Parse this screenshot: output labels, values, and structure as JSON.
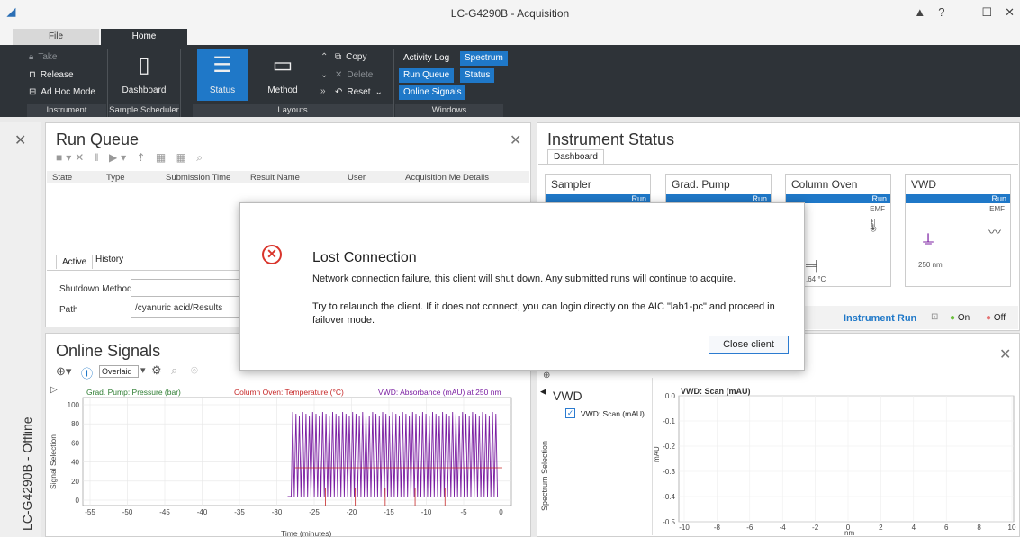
{
  "window": {
    "title": "LC-G4290B - Acquisition",
    "controls": [
      "▲",
      "?",
      "—",
      "☐",
      "✕"
    ]
  },
  "tabs": {
    "file": "File",
    "home": "Home"
  },
  "ribbon": {
    "instrument": {
      "take": "Take",
      "release": "Release",
      "adhoc": "Ad Hoc Mode",
      "label": "Instrument"
    },
    "scheduler": {
      "dashboard": "Dashboard",
      "label": "Sample Scheduler"
    },
    "layouts": {
      "status": "Status",
      "method": "Method",
      "copy": "Copy",
      "delete": "Delete",
      "reset": "Reset",
      "label": "Layouts"
    },
    "windows": {
      "activity_log": "Activity Log",
      "spectrum": "Spectrum",
      "run_queue": "Run Queue",
      "status": "Status",
      "online_signals": "Online Signals",
      "label": "Windows"
    }
  },
  "side": {
    "label": "LC-G4290B - Offline"
  },
  "run_queue": {
    "title": "Run Queue",
    "columns": [
      "State",
      "Type",
      "Submission Time",
      "Result Name",
      "User",
      "Acquisition Me",
      "Details"
    ],
    "subtabs": {
      "active": "Active",
      "history": "History"
    },
    "shutdown_label": "Shutdown Method",
    "shutdown_value": "",
    "path_label": "Path",
    "path_value": "/cyanuric acid/Results"
  },
  "instrument_status": {
    "title": "Instrument Status",
    "tab": "Dashboard",
    "cards": [
      {
        "name": "Sampler",
        "state": "Run"
      },
      {
        "name": "Grad. Pump",
        "state": "Run"
      },
      {
        "name": "Column Oven",
        "state": "Run",
        "emf": "EMF",
        "temp": ".64 °C"
      },
      {
        "name": "VWD",
        "state": "Run",
        "emf": "EMF",
        "wavelength": "250 nm"
      }
    ],
    "footer": {
      "run": "Instrument Run",
      "on": "On",
      "off": "Off"
    }
  },
  "online_signals": {
    "title": "Online Signals",
    "mode": "Overlaid",
    "legend": [
      "Grad. Pump: Pressure (bar)",
      "Column Oven: Temperature (°C)",
      "VWD: Absorbance (mAU) at 250 nm"
    ],
    "ylabel": "Signal Selection",
    "xlabel": "Time (minutes)",
    "yticks": [
      "100",
      "80",
      "60",
      "40",
      "20",
      "0"
    ],
    "xticks": [
      "-55",
      "-50",
      "-45",
      "-40",
      "-35",
      "-30",
      "-25",
      "-20",
      "-15",
      "-10",
      "-5",
      "0"
    ]
  },
  "spectrum": {
    "detector": "VWD",
    "checkbox_label": "VWD: Scan (mAU)",
    "side_label": "Spectrum Selection",
    "plot_title": "VWD: Scan (mAU)",
    "ylabel": "mAU",
    "xlabel": "nm",
    "yticks": [
      "0.0",
      "-0.1",
      "-0.2",
      "-0.3",
      "-0.4",
      "-0.5"
    ],
    "xticks": [
      "-10",
      "-8",
      "-6",
      "-4",
      "-2",
      "0",
      "2",
      "4",
      "6",
      "8",
      "10"
    ]
  },
  "dialog": {
    "title": "Lost Connection",
    "message1": "Network connection failure, this client will shut down. Any submitted runs will continue to acquire.",
    "message2": "Try to relaunch the client. If it does not connect, you can login directly on the AIC \"lab1-pc\" and proceed in failover mode.",
    "button": "Close client"
  },
  "colors": {
    "accent": "#1f78c8",
    "ribbon": "#2e3338",
    "error": "#d9342b",
    "pressure": "#2e7d32",
    "temperature": "#c62828",
    "absorbance": "#7b1fa2"
  }
}
